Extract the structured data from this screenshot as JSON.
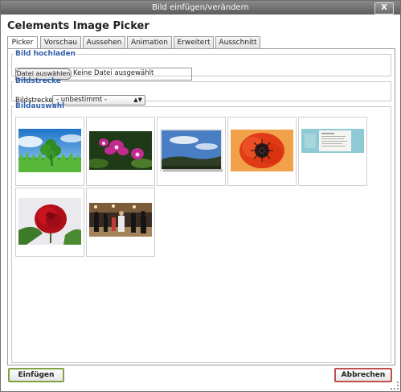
{
  "window": {
    "title": "Bild einfügen/verändern",
    "close_label": "X"
  },
  "app_title": "Celements Image Picker",
  "tabs": [
    {
      "label": "Picker",
      "active": true
    },
    {
      "label": "Vorschau",
      "active": false
    },
    {
      "label": "Aussehen",
      "active": false
    },
    {
      "label": "Animation",
      "active": false
    },
    {
      "label": "Erweitert",
      "active": false
    },
    {
      "label": "Ausschnitt",
      "active": false
    }
  ],
  "upload": {
    "legend": "Bild hochladen",
    "button_label": "Datei auswählen",
    "status": "Keine Datei ausgewählt"
  },
  "gallery_section": {
    "legend": "Bildstrecke",
    "label": "Bildstrecke",
    "selected": "- unbestimmt -"
  },
  "selection": {
    "legend": "Bildauswahl",
    "images": [
      {
        "subject": "clover"
      },
      {
        "subject": "orchid"
      },
      {
        "subject": "landscape"
      },
      {
        "subject": "poppy"
      },
      {
        "subject": "document"
      },
      {
        "subject": "rose"
      },
      {
        "subject": "party"
      }
    ]
  },
  "footer": {
    "insert_label": "Einfügen",
    "cancel_label": "Abbrechen"
  },
  "colors": {
    "legend_blue": "#2f5fa8",
    "insert_border": "#7ea343",
    "cancel_border": "#c0504d"
  }
}
